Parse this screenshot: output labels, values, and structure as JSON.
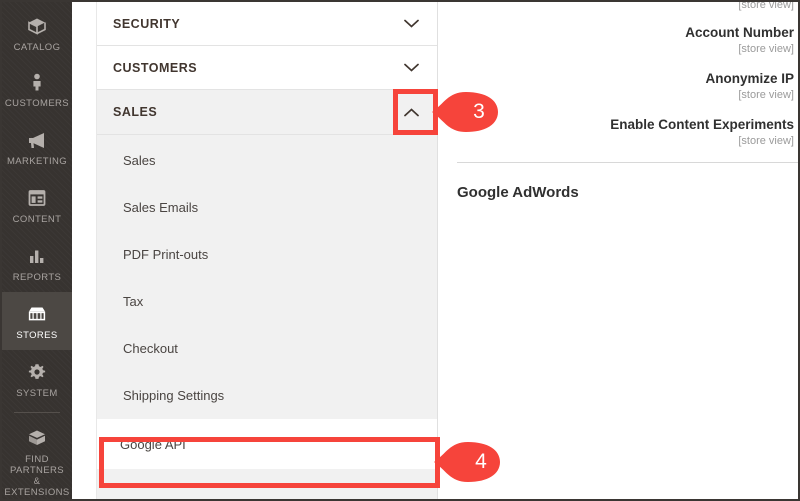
{
  "sidebar": {
    "items": [
      {
        "label": "CATALOG",
        "icon": "catalog-box-icon",
        "active": false
      },
      {
        "label": "CUSTOMERS",
        "icon": "customers-person-icon",
        "active": false
      },
      {
        "label": "MARKETING",
        "icon": "marketing-megaphone-icon",
        "active": false
      },
      {
        "label": "CONTENT",
        "icon": "content-layout-icon",
        "active": false
      },
      {
        "label": "REPORTS",
        "icon": "reports-bar-chart-icon",
        "active": false
      },
      {
        "label": "STORES",
        "icon": "stores-storefront-icon",
        "active": true
      },
      {
        "label": "SYSTEM",
        "icon": "system-gear-icon",
        "active": false
      },
      {
        "label": "FIND PARTNERS\n& EXTENSIONS",
        "icon": "extensions-package-icon",
        "active": false
      }
    ],
    "find_partners_line1": "FIND PARTNERS",
    "find_partners_line2": "& EXTENSIONS"
  },
  "menu": {
    "sections": [
      {
        "title": "SECURITY",
        "state": "collapsed",
        "chevron": "chevron-down-icon"
      },
      {
        "title": "CUSTOMERS",
        "state": "collapsed",
        "chevron": "chevron-down-icon"
      },
      {
        "title": "SALES",
        "state": "expanded",
        "chevron": "chevron-up-icon"
      }
    ],
    "sales_subitems": [
      {
        "label": "Sales"
      },
      {
        "label": "Sales Emails"
      },
      {
        "label": "PDF Print-outs"
      },
      {
        "label": "Tax"
      },
      {
        "label": "Checkout"
      },
      {
        "label": "Shipping Settings"
      },
      {
        "label": "Google API"
      }
    ]
  },
  "content": {
    "fields": [
      {
        "label": "",
        "scope": "[store view]"
      },
      {
        "label": "Account Number",
        "scope": "[store view]"
      },
      {
        "label": "Anonymize IP",
        "scope": "[store view]"
      },
      {
        "label": "Enable Content Experiments",
        "scope": "[store view]"
      }
    ],
    "section_heading": "Google AdWords"
  },
  "annotations": {
    "callouts": [
      {
        "number": "3",
        "target": "sales-chevron-toggle"
      },
      {
        "number": "4",
        "target": "google-api-menu-item"
      }
    ],
    "accent_color": "#f6443b"
  }
}
